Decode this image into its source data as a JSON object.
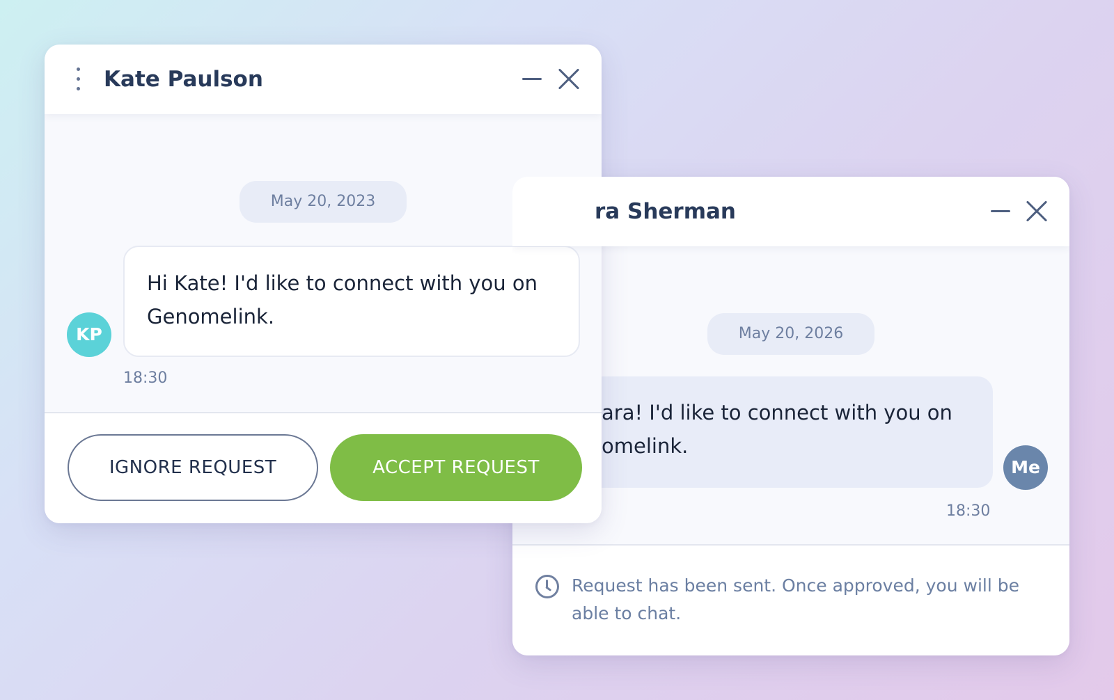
{
  "colors": {
    "accept_button": "#7fbd46",
    "kp_avatar": "#5bd2d8",
    "me_avatar": "#6a86ab",
    "title_text": "#283a5a",
    "muted_text": "#6e7fa0"
  },
  "back_window": {
    "title": "ra Sherman",
    "date": "May 20, 2026",
    "message_lines": [
      "ara! I'd like to connect with you on",
      "omelink."
    ],
    "message_time": "18:30",
    "avatar_initials": "Me",
    "status_icon": "clock-icon",
    "status_lines": [
      "Request has been sent. Once approved, you will be",
      "able to chat."
    ],
    "header_icons": [
      "minimize-icon",
      "close-icon"
    ]
  },
  "front_window": {
    "title": "Kate Paulson",
    "date": "May 20, 2023",
    "message_lines": [
      "Hi Kate! I'd like to connect with you on",
      "Genomelink."
    ],
    "message_time": "18:30",
    "avatar_initials": "KP",
    "ignore_label": "IGNORE REQUEST",
    "accept_label": "ACCEPT REQUEST",
    "header_icons": [
      "more-vertical-icon",
      "minimize-icon",
      "close-icon"
    ]
  }
}
